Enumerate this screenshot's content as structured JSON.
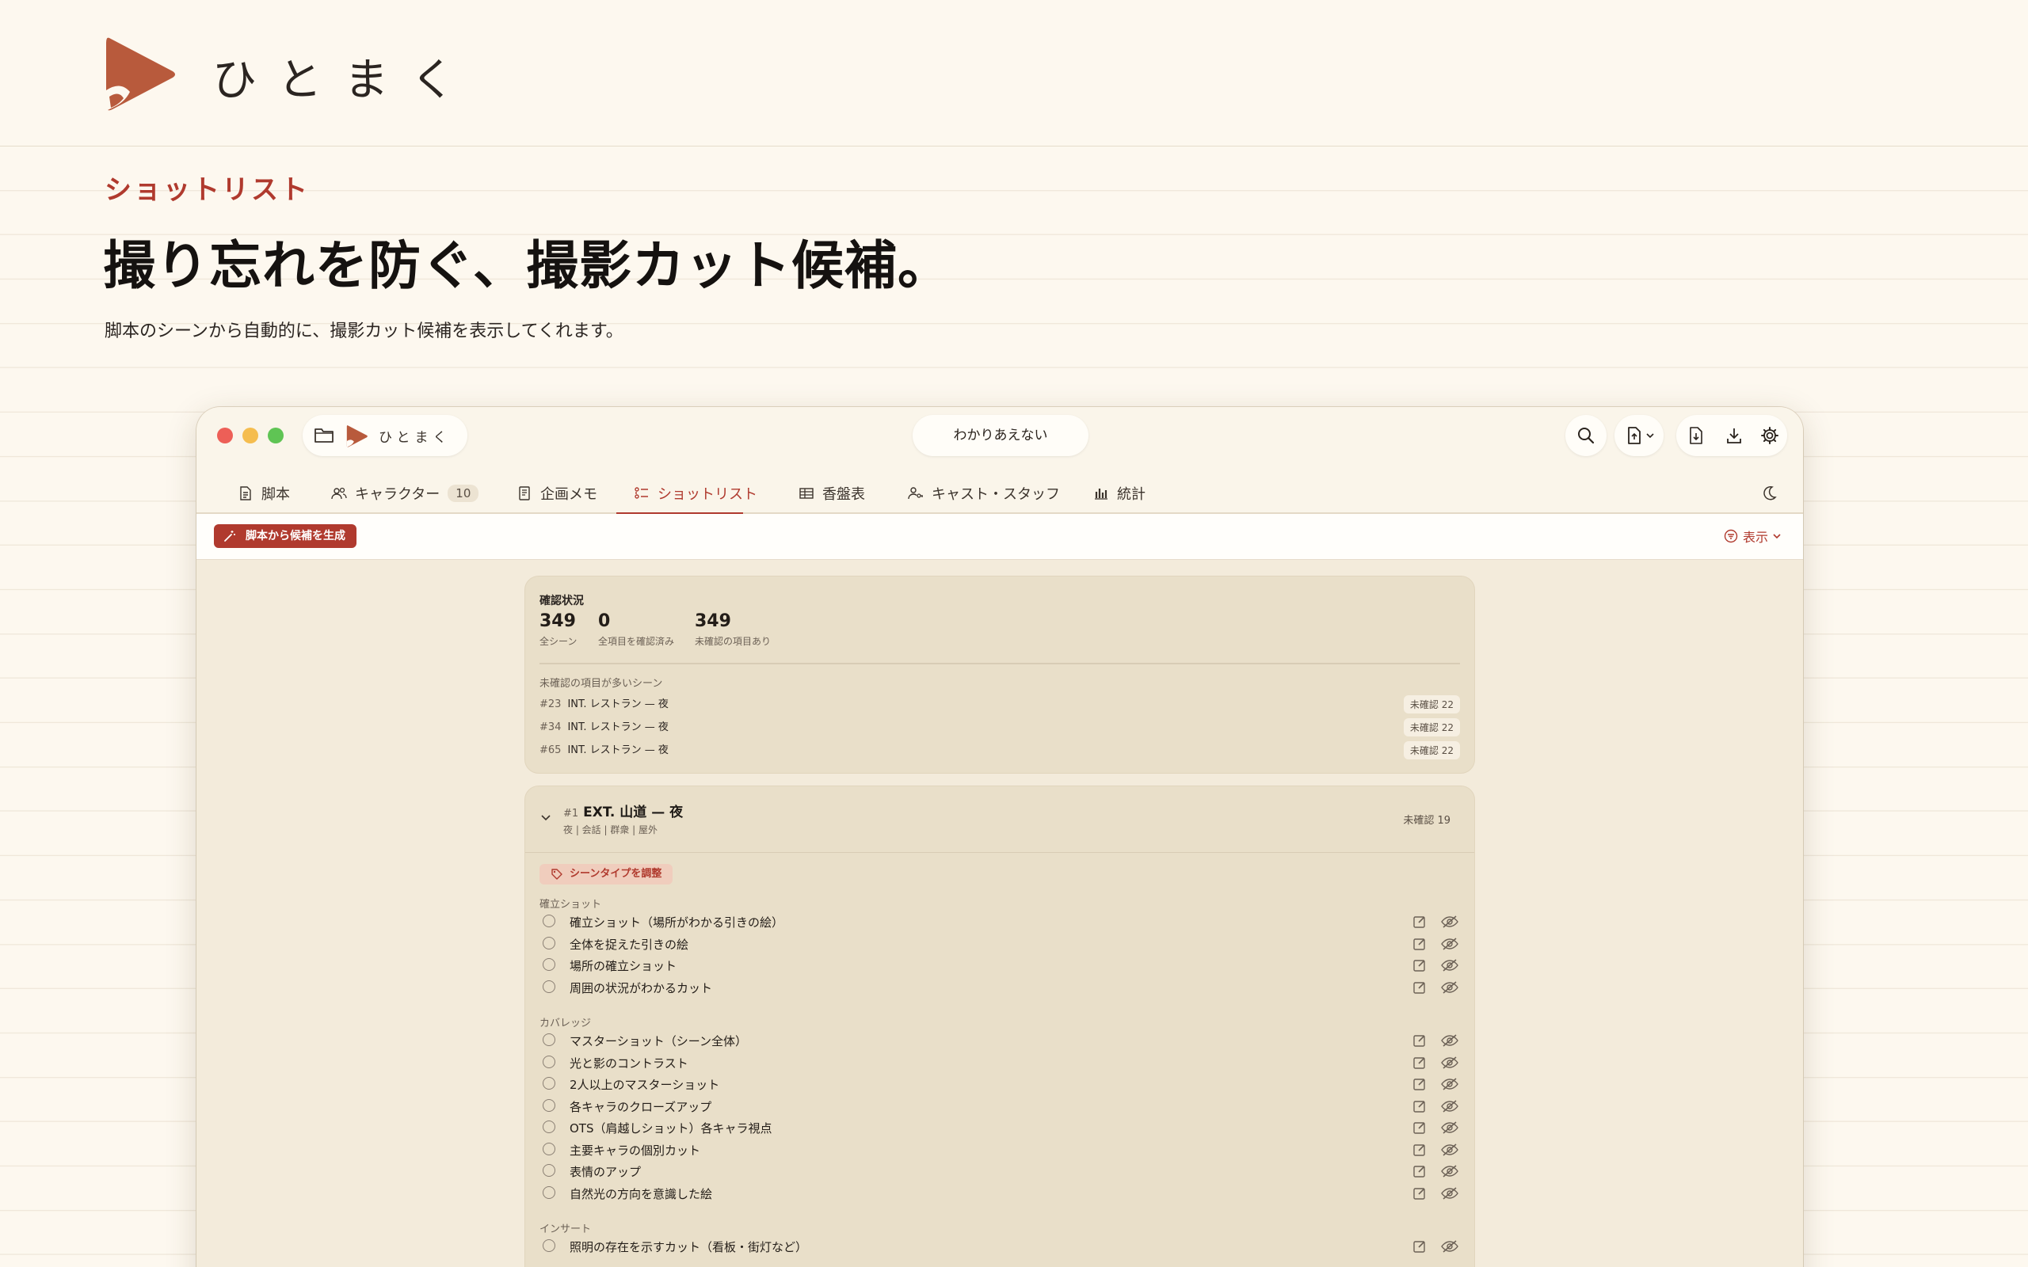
{
  "brand": {
    "logo_text": "ひとまく",
    "accent": "#b03a2e"
  },
  "hero": {
    "kicker": "ショットリスト",
    "headline": "撮り忘れを防ぐ、撮影カット候補。",
    "lede": "脚本のシーンから自動的に、撮影カット候補を表示してくれます。"
  },
  "window": {
    "project_name": "ひとまく",
    "document_title": "わかりあえない",
    "tabs": [
      {
        "label": "脚本",
        "icon": "document-icon"
      },
      {
        "label": "キャラクター",
        "icon": "users-icon",
        "badge": "10"
      },
      {
        "label": "企画メモ",
        "icon": "notebook-icon"
      },
      {
        "label": "ショットリスト",
        "icon": "checklist-icon",
        "active": true
      },
      {
        "label": "香盤表",
        "icon": "table-icon"
      },
      {
        "label": "キャスト・スタッフ",
        "icon": "person-key-icon"
      },
      {
        "label": "統計",
        "icon": "bar-chart-icon"
      }
    ],
    "toolbar": {
      "generate_label": "脚本から候補を生成",
      "view_label": "表示"
    }
  },
  "summary": {
    "title": "確認状況",
    "stats": [
      {
        "value": "349",
        "label": "全シーン"
      },
      {
        "value": "0",
        "label": "全項目を確認済み"
      },
      {
        "value": "349",
        "label": "未確認の項目あり"
      }
    ],
    "subheading": "未確認の項目が多いシーン",
    "rows": [
      {
        "num": "#23",
        "name": "INT. レストラン — 夜",
        "chip": "未確認 22"
      },
      {
        "num": "#34",
        "name": "INT. レストラン — 夜",
        "chip": "未確認 22"
      },
      {
        "num": "#65",
        "name": "INT. レストラン — 夜",
        "chip": "未確認 22"
      }
    ]
  },
  "scene": {
    "num": "#1",
    "title": "EXT. 山道 — 夜",
    "tags": "夜 | 会話 | 群衆 | 屋外",
    "count": "未確認 19",
    "adjust_label": "シーンタイプを調整",
    "groups": [
      {
        "label": "確立ショット",
        "items": [
          "確立ショット（場所がわかる引きの絵）",
          "全体を捉えた引きの絵",
          "場所の確立ショット",
          "周囲の状況がわかるカット"
        ]
      },
      {
        "label": "カバレッジ",
        "items": [
          "マスターショット（シーン全体）",
          "光と影のコントラスト",
          "2人以上のマスターショット",
          "各キャラのクローズアップ",
          "OTS（肩越しショット）各キャラ視点",
          "主要キャラの個別カット",
          "表情のアップ",
          "自然光の方向を意識した絵"
        ]
      },
      {
        "label": "インサート",
        "items": [
          "照明の存在を示すカット（看板・街灯など）"
        ]
      }
    ]
  }
}
